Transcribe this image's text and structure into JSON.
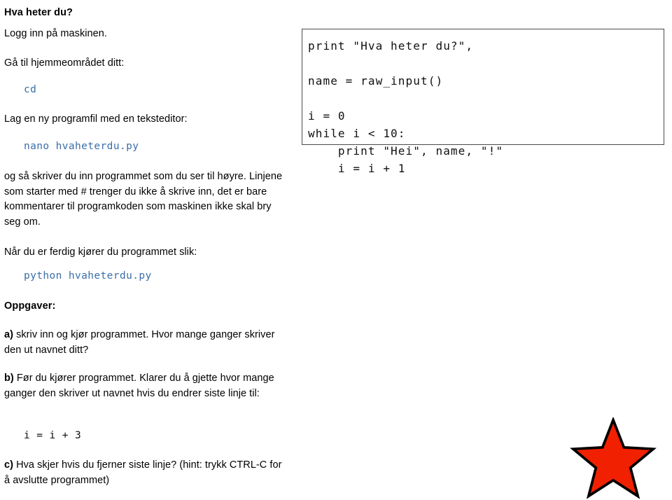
{
  "document": {
    "title": "Hva heter du?",
    "language": "no",
    "blocks": {
      "heading": "Hva heter du?",
      "step_login": "Logg inn på maskinen.",
      "step_home": "Gå til hjemmeområdet ditt:",
      "cmd_cd": "cd",
      "step_editor": "Lag en ny programfil med en teksteditor:",
      "cmd_nano": "nano hvaheterdu.py",
      "explain": "og så skriver du inn programmet som du ser til høyre. Linjene som starter med # trenger du ikke å skrive inn, det er bare kommentarer til programkoden som maskinen ikke skal bry seg om.",
      "step_run": "Når du er ferdig kjører du programmet slik:",
      "cmd_python": "python hvaheterdu.py",
      "exercises_heading": "Oppgaver:",
      "exercise_a_label": "a)",
      "exercise_a_text": " skriv inn og kjør programmet. Hvor mange ganger skriver den ut navnet ditt?",
      "exercise_b_label": "b)",
      "exercise_b_text": " Før du kjører programmet. Klarer du å gjette hvor mange ganger den skriver ut navnet hvis du endrer siste linje til:",
      "cmd_i_plus_3": "i = i + 3",
      "exercise_c_label": "c)",
      "exercise_c_text": " Hva skjer hvis du fjerner siste linje? (hint: trykk CTRL-C for å avslutte programmet)"
    }
  },
  "code_box": {
    "language": "python",
    "lines": [
      "print \"Hva heter du?\",",
      "",
      "name = raw_input()",
      "",
      "i = 0",
      "while i < 10:",
      "    print \"Hei\", name, \"!\"",
      "    i = i + 1"
    ],
    "text": "print \"Hva heter du?\",\n\nname = raw_input()\n\ni = 0\nwhile i < 10:\n    print \"Hei\", name, \"!\"\n    i = i + 1"
  },
  "decoration": {
    "star": {
      "name": "red-star",
      "fill": "#f02000",
      "stroke": "#000000"
    }
  },
  "colors": {
    "code_blue": "#3a6ea8",
    "text_black": "#000000",
    "box_border": "#4a4a4a",
    "page_background": "#ffffff"
  }
}
